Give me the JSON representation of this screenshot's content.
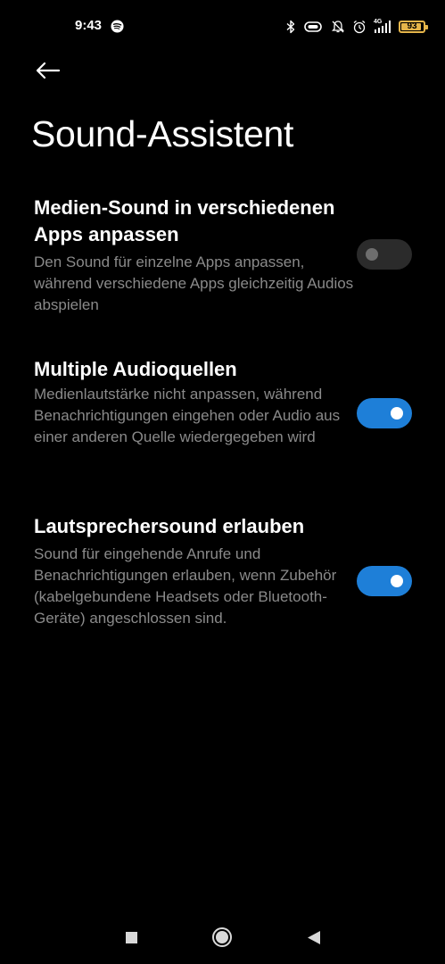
{
  "status_bar": {
    "time": "9:43",
    "network_label": "4G",
    "battery_level": "93",
    "battery_percent": 93,
    "icons": [
      "spotify-icon",
      "bluetooth-icon",
      "vibrate-icon",
      "alarm-off-icon",
      "alarm-clock-icon",
      "signal-icon",
      "battery-icon"
    ]
  },
  "header": {
    "back_icon": "back-arrow-icon",
    "title": "Sound-Assistent"
  },
  "settings": [
    {
      "title": "Medien-Sound in verschiedenen Apps anpassen",
      "description": "Den Sound für einzelne Apps anpassen, während verschiedene Apps gleichzeitig Audios abspielen",
      "enabled": false
    },
    {
      "title": "Multiple Audioquellen",
      "description": "Medienlautstärke nicht anpassen, während Benachrichtigungen eingehen oder Audio aus einer anderen Quelle wiedergegeben wird",
      "enabled": true
    },
    {
      "title": "Lautsprechersound erlauben",
      "description": "Sound für eingehende Anrufe und Benachrichtigungen erlauben, wenn Zubehör (kabelgebundene Headsets oder Bluetooth-Geräte) angeschlossen sind.",
      "enabled": true
    }
  ],
  "nav_bar": {
    "icons": [
      "recents-square-icon",
      "home-circle-icon",
      "back-triangle-icon"
    ]
  },
  "colors": {
    "background": "#000000",
    "title_text": "#ffffff",
    "secondary_text": "#8a8a8a",
    "toggle_on": "#1e7fd8",
    "toggle_off": "#2b2b2b",
    "battery": "#e6b54a"
  }
}
